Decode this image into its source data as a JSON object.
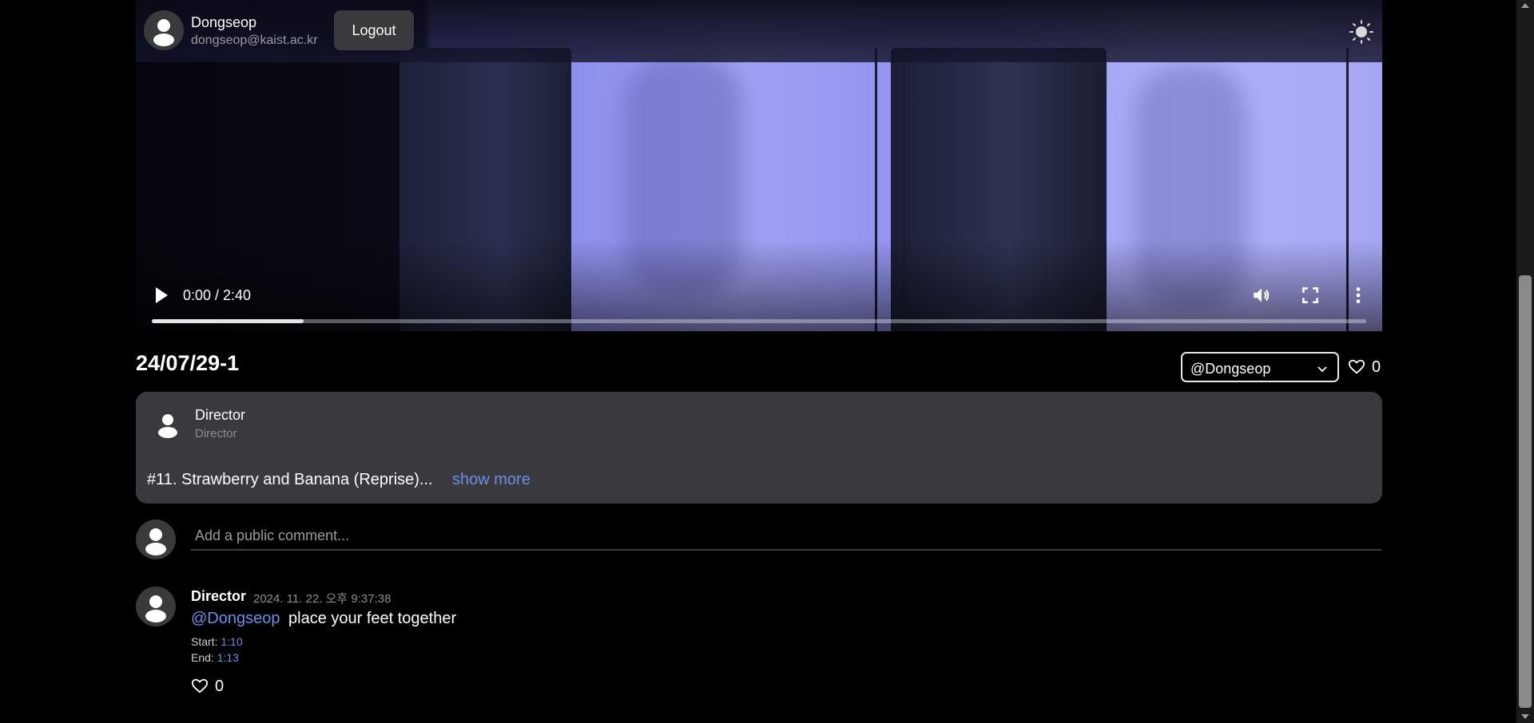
{
  "user": {
    "name": "Dongseop",
    "email": "dongseop@kaist.ac.kr",
    "logout_label": "Logout"
  },
  "video": {
    "timecode": "0:00 / 2:40",
    "progress_fraction": 0.125
  },
  "icons": {
    "avatar": "user-avatar-icon",
    "theme": "sun-icon",
    "play": "play-icon",
    "volume": "volume-icon",
    "fullscreen": "fullscreen-icon",
    "more": "more-vertical-icon",
    "like": "heart-icon",
    "chevron": "chevron-down-icon"
  },
  "post": {
    "title": "24/07/29-1",
    "mention_select_value": "@Dongseop",
    "likes": "0",
    "author_name": "Director",
    "author_role": "Director",
    "description": "#11. Strawberry and Banana (Reprise)...",
    "show_more": "show more"
  },
  "comment_input": {
    "placeholder": "Add a public comment..."
  },
  "comments": [
    {
      "author": "Director",
      "date": "2024. 11. 22. 오후 9:37:38",
      "mention": "@Dongseop",
      "text": "place your feet together",
      "start_label": "Start:",
      "start": "1:10",
      "end_label": "End:",
      "end": "1:13",
      "likes": "0"
    }
  ],
  "colors": {
    "accent_link": "#6a8fe6",
    "card_bg": "#3a3a3e",
    "page_bg": "#000000"
  }
}
